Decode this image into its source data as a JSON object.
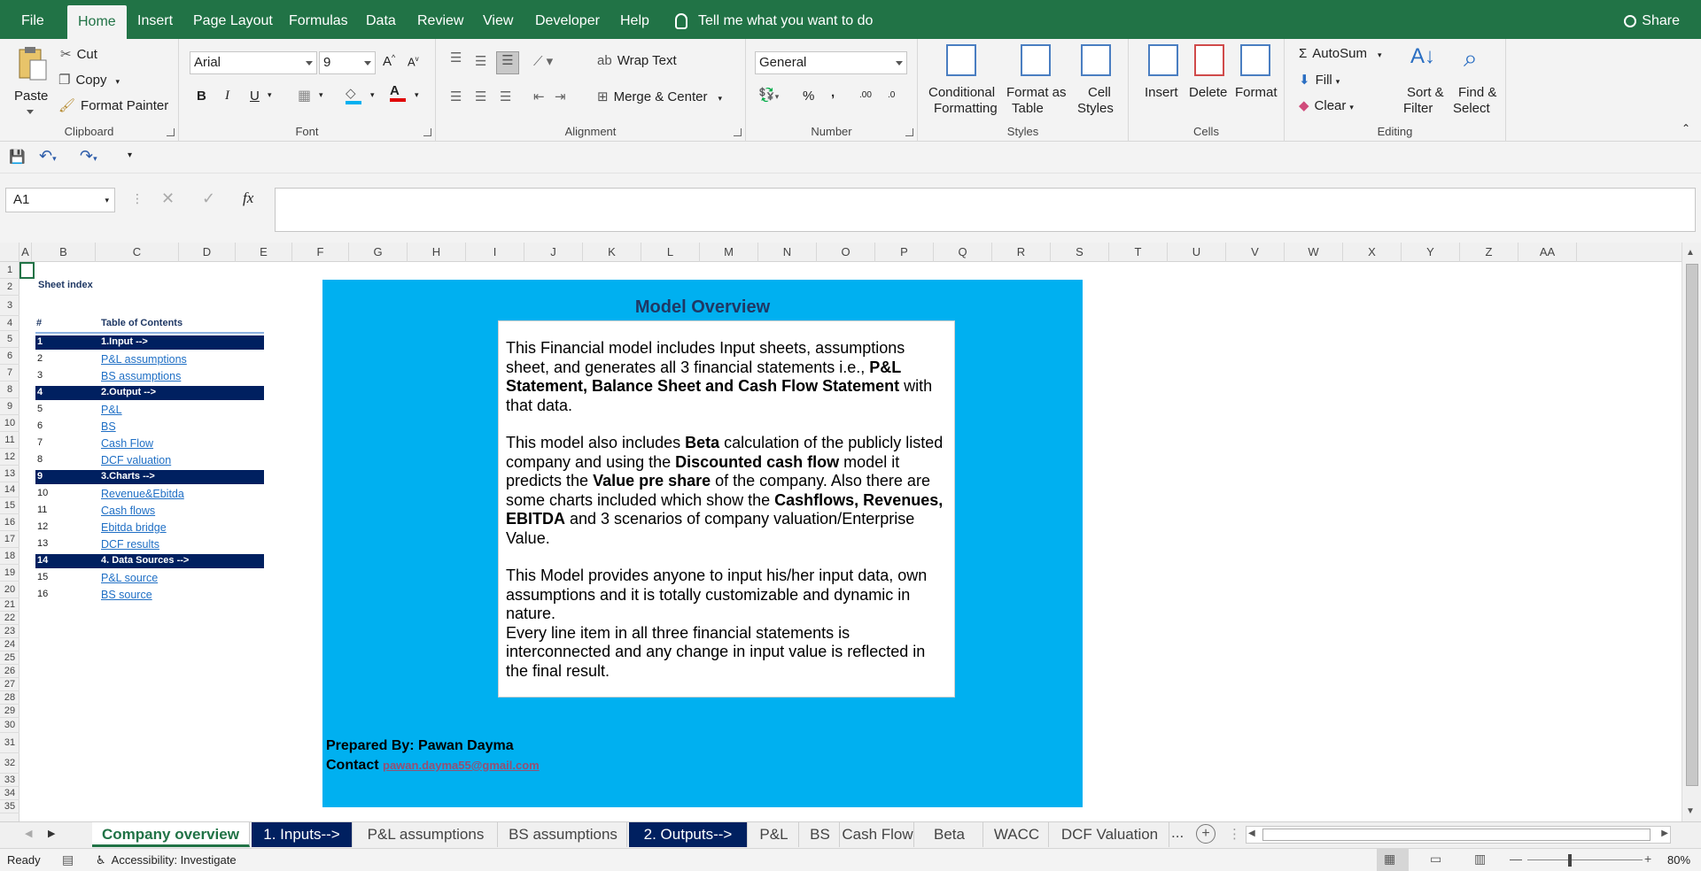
{
  "menu": {
    "file": "File",
    "home": "Home",
    "insert": "Insert",
    "page_layout": "Page Layout",
    "formulas": "Formulas",
    "data": "Data",
    "review": "Review",
    "view": "View",
    "developer": "Developer",
    "help": "Help",
    "tell_me": "Tell me what you want to do",
    "share": "Share"
  },
  "ribbon": {
    "clipboard": {
      "label": "Clipboard",
      "paste": "Paste",
      "cut": "Cut",
      "copy": "Copy",
      "format_painter": "Format Painter"
    },
    "font": {
      "label": "Font",
      "font_name": "Arial",
      "font_size": "9",
      "bold": "B",
      "italic": "I",
      "underline": "U"
    },
    "alignment": {
      "label": "Alignment",
      "wrap_text": "Wrap Text",
      "merge_center": "Merge & Center"
    },
    "number": {
      "label": "Number",
      "format": "General",
      "percent": "%",
      "comma": ",",
      "inc_decimal": ".00",
      "dec_decimal": ".0"
    },
    "styles": {
      "label": "Styles",
      "conditional_formatting_1": "Conditional",
      "conditional_formatting_2": "Formatting",
      "format_as_table_1": "Format as",
      "format_as_table_2": "Table",
      "cell_styles_1": "Cell",
      "cell_styles_2": "Styles"
    },
    "cells": {
      "label": "Cells",
      "insert": "Insert",
      "delete": "Delete",
      "format": "Format"
    },
    "editing": {
      "label": "Editing",
      "autosum": "AutoSum",
      "fill": "Fill",
      "clear": "Clear",
      "sort_filter_1": "Sort &",
      "sort_filter_2": "Filter",
      "find_select_1": "Find &",
      "find_select_2": "Select"
    }
  },
  "formula_bar": {
    "name_box": "A1",
    "fx": "fx",
    "value": ""
  },
  "columns": [
    "A",
    "B",
    "C",
    "D",
    "E",
    "F",
    "G",
    "H",
    "I",
    "J",
    "K",
    "L",
    "M",
    "N",
    "O",
    "P",
    "Q",
    "R",
    "S",
    "T",
    "U",
    "V",
    "W",
    "X",
    "Y",
    "Z",
    "AA"
  ],
  "rows": [
    "1",
    "2",
    "3",
    "4",
    "5",
    "6",
    "7",
    "8",
    "9",
    "10",
    "11",
    "12",
    "13",
    "14",
    "15",
    "16",
    "17",
    "18",
    "19",
    "20",
    "21",
    "22",
    "23",
    "24",
    "25",
    "26",
    "27",
    "28",
    "29",
    "30",
    "31",
    "32",
    "33",
    "34",
    "35"
  ],
  "sheet_index": {
    "title": "Sheet index",
    "col_num": "#",
    "col_toc": "Table of Contents",
    "entries": [
      {
        "num": "1",
        "label": "1.Input -->",
        "header": true
      },
      {
        "num": "2",
        "label": "P&L assumptions",
        "header": false
      },
      {
        "num": "3",
        "label": "BS assumptions",
        "header": false
      },
      {
        "num": "4",
        "label": "2.Output -->",
        "header": true
      },
      {
        "num": "5",
        "label": "P&L",
        "header": false
      },
      {
        "num": "6",
        "label": "BS",
        "header": false
      },
      {
        "num": "7",
        "label": "Cash Flow",
        "header": false
      },
      {
        "num": "8",
        "label": "DCF valuation",
        "header": false
      },
      {
        "num": "9",
        "label": "3.Charts -->",
        "header": true
      },
      {
        "num": "10",
        "label": "Revenue&Ebitda",
        "header": false
      },
      {
        "num": "11",
        "label": "Cash flows",
        "header": false
      },
      {
        "num": "12",
        "label": "Ebitda bridge",
        "header": false
      },
      {
        "num": "13",
        "label": "DCF results",
        "header": false
      },
      {
        "num": "14",
        "label": "4. Data Sources -->",
        "header": true
      },
      {
        "num": "15",
        "label": "P&L source",
        "header": false
      },
      {
        "num": "16",
        "label": "BS source",
        "header": false
      }
    ]
  },
  "overview": {
    "title": "Model Overview",
    "p1_a": "This Financial model includes Input sheets, assumptions sheet, and generates all 3 financial statements i.e., ",
    "p1_b": "P&L Statement, Balance Sheet and Cash Flow Statement",
    "p1_c": " with that data.",
    "p2_a": "This model also includes ",
    "p2_b": "Beta",
    "p2_c": " calculation of the publicly listed company and using the ",
    "p2_d": "Discounted cash flow",
    "p2_e": " model it predicts the ",
    "p2_f": "Value pre share",
    "p2_g": " of the company. Also there are some charts included which show the ",
    "p2_h": "Cashflows, Revenues, EBITDA",
    "p2_i": " and 3 scenarios of company valuation/Enterprise Value.",
    "p3_a": "This Model provides anyone to input his/her input data, own assumptions and it is totally customizable and dynamic in nature.",
    "p3_b": "Every line item in all three financial statements is interconnected and any change in input value is reflected in the final result.",
    "prepared_by": "Prepared By: Pawan Dayma",
    "contact_label": "Contact",
    "contact_email": "pawan.dayma55@gmail.com"
  },
  "tabs": [
    {
      "label": "Company overview",
      "style": "active"
    },
    {
      "label": "1. Inputs-->",
      "style": "dark"
    },
    {
      "label": "P&L assumptions",
      "style": "normal"
    },
    {
      "label": "BS assumptions",
      "style": "normal"
    },
    {
      "label": "2. Outputs-->",
      "style": "dark"
    },
    {
      "label": "P&L",
      "style": "normal"
    },
    {
      "label": "BS",
      "style": "normal"
    },
    {
      "label": "Cash Flow",
      "style": "normal"
    },
    {
      "label": "Beta",
      "style": "normal"
    },
    {
      "label": "WACC",
      "style": "normal"
    },
    {
      "label": "DCF Valuation",
      "style": "normal"
    }
  ],
  "tabs_more": "...",
  "status": {
    "ready": "Ready",
    "accessibility": "Accessibility: Investigate",
    "zoom": "80%"
  },
  "colors": {
    "excel_green": "#217346",
    "navy": "#002060",
    "panel_blue": "#00b0f0",
    "title_navy": "#1f3864",
    "link_blue": "#1f6fc5",
    "email_purple": "#954f72"
  }
}
